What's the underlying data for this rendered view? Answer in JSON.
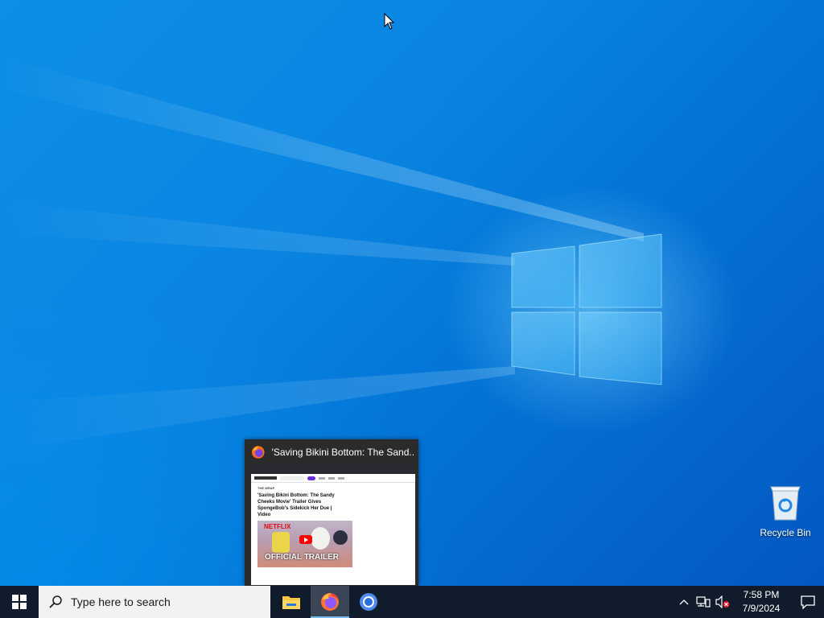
{
  "desktop": {
    "icons": [
      {
        "label": "Recycle Bin",
        "icon": "recycle-bin-icon"
      }
    ]
  },
  "preview": {
    "window_title": "'Saving Bikini Bottom: The Sand...",
    "app_icon": "firefox-icon",
    "thumbnail": {
      "tag": "THE WRAP",
      "headline": "'Saving Bikini Bottom: The Sandy Cheeks Movie' Trailer Gives SpongeBob's Sidekick Her Due | Video",
      "video_brand": "NETFLIX",
      "video_caption": "OFFICIAL TRAILER"
    }
  },
  "taskbar": {
    "start_icon": "windows-start-icon",
    "search_placeholder": "Type here to search",
    "search_icon": "search-icon",
    "pinned": [
      {
        "name": "File Explorer",
        "icon": "file-explorer-icon",
        "active": false
      },
      {
        "name": "Firefox",
        "icon": "firefox-icon",
        "active": true
      },
      {
        "name": "Chromium",
        "icon": "chromium-icon",
        "active": false
      }
    ],
    "tray": {
      "icons": [
        "chevron-up-icon",
        "network-icon",
        "volume-muted-icon"
      ],
      "time": "7:58 PM",
      "date": "7/9/2024",
      "notification_icon": "action-center-icon"
    }
  },
  "colors": {
    "taskbar_bg": "#101c2b",
    "desktop_accent": "#0a86e2",
    "search_bg": "#f2f2f2"
  }
}
